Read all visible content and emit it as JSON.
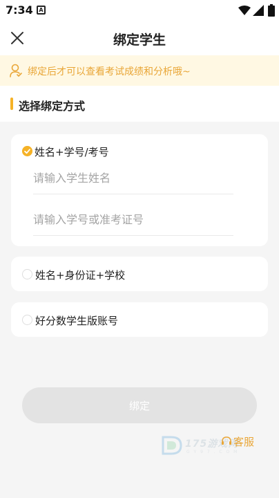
{
  "status": {
    "time": "7:34",
    "notification_badge": "A"
  },
  "header": {
    "title": "绑定学生"
  },
  "tip": {
    "text": "绑定后才可以查看考试成绩和分析哦~"
  },
  "section": {
    "title": "选择绑定方式"
  },
  "options": [
    {
      "label": "姓名+学号/考号",
      "selected": true,
      "fields": [
        {
          "placeholder": "请输入学生姓名",
          "value": ""
        },
        {
          "placeholder": "请输入学号或准考证号",
          "value": ""
        }
      ]
    },
    {
      "label": "姓名+身份证+学校",
      "selected": false
    },
    {
      "label": "好分数学生版账号",
      "selected": false
    }
  ],
  "bind_button": {
    "label": "绑定",
    "enabled": false
  },
  "service": {
    "label": "客服"
  },
  "watermark": {
    "text": "175游戏网",
    "sub": "G Y 9 7 . C O M"
  },
  "colors": {
    "accent": "#f5b227",
    "tip_bg": "#fff8e3",
    "tip_text": "#e9a637",
    "button_disabled": "#e3e3e3"
  }
}
